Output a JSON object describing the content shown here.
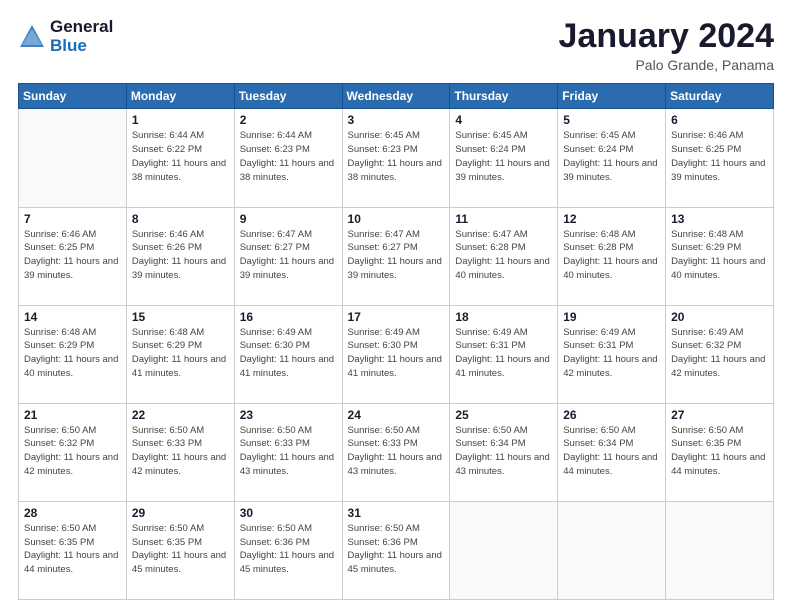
{
  "header": {
    "logo_general": "General",
    "logo_blue": "Blue",
    "month_title": "January 2024",
    "location": "Palo Grande, Panama"
  },
  "days_of_week": [
    "Sunday",
    "Monday",
    "Tuesday",
    "Wednesday",
    "Thursday",
    "Friday",
    "Saturday"
  ],
  "weeks": [
    [
      {
        "day": "",
        "sunrise": "",
        "sunset": "",
        "daylight": ""
      },
      {
        "day": "1",
        "sunrise": "Sunrise: 6:44 AM",
        "sunset": "Sunset: 6:22 PM",
        "daylight": "Daylight: 11 hours and 38 minutes."
      },
      {
        "day": "2",
        "sunrise": "Sunrise: 6:44 AM",
        "sunset": "Sunset: 6:23 PM",
        "daylight": "Daylight: 11 hours and 38 minutes."
      },
      {
        "day": "3",
        "sunrise": "Sunrise: 6:45 AM",
        "sunset": "Sunset: 6:23 PM",
        "daylight": "Daylight: 11 hours and 38 minutes."
      },
      {
        "day": "4",
        "sunrise": "Sunrise: 6:45 AM",
        "sunset": "Sunset: 6:24 PM",
        "daylight": "Daylight: 11 hours and 39 minutes."
      },
      {
        "day": "5",
        "sunrise": "Sunrise: 6:45 AM",
        "sunset": "Sunset: 6:24 PM",
        "daylight": "Daylight: 11 hours and 39 minutes."
      },
      {
        "day": "6",
        "sunrise": "Sunrise: 6:46 AM",
        "sunset": "Sunset: 6:25 PM",
        "daylight": "Daylight: 11 hours and 39 minutes."
      }
    ],
    [
      {
        "day": "7",
        "sunrise": "Sunrise: 6:46 AM",
        "sunset": "Sunset: 6:25 PM",
        "daylight": "Daylight: 11 hours and 39 minutes."
      },
      {
        "day": "8",
        "sunrise": "Sunrise: 6:46 AM",
        "sunset": "Sunset: 6:26 PM",
        "daylight": "Daylight: 11 hours and 39 minutes."
      },
      {
        "day": "9",
        "sunrise": "Sunrise: 6:47 AM",
        "sunset": "Sunset: 6:27 PM",
        "daylight": "Daylight: 11 hours and 39 minutes."
      },
      {
        "day": "10",
        "sunrise": "Sunrise: 6:47 AM",
        "sunset": "Sunset: 6:27 PM",
        "daylight": "Daylight: 11 hours and 39 minutes."
      },
      {
        "day": "11",
        "sunrise": "Sunrise: 6:47 AM",
        "sunset": "Sunset: 6:28 PM",
        "daylight": "Daylight: 11 hours and 40 minutes."
      },
      {
        "day": "12",
        "sunrise": "Sunrise: 6:48 AM",
        "sunset": "Sunset: 6:28 PM",
        "daylight": "Daylight: 11 hours and 40 minutes."
      },
      {
        "day": "13",
        "sunrise": "Sunrise: 6:48 AM",
        "sunset": "Sunset: 6:29 PM",
        "daylight": "Daylight: 11 hours and 40 minutes."
      }
    ],
    [
      {
        "day": "14",
        "sunrise": "Sunrise: 6:48 AM",
        "sunset": "Sunset: 6:29 PM",
        "daylight": "Daylight: 11 hours and 40 minutes."
      },
      {
        "day": "15",
        "sunrise": "Sunrise: 6:48 AM",
        "sunset": "Sunset: 6:29 PM",
        "daylight": "Daylight: 11 hours and 41 minutes."
      },
      {
        "day": "16",
        "sunrise": "Sunrise: 6:49 AM",
        "sunset": "Sunset: 6:30 PM",
        "daylight": "Daylight: 11 hours and 41 minutes."
      },
      {
        "day": "17",
        "sunrise": "Sunrise: 6:49 AM",
        "sunset": "Sunset: 6:30 PM",
        "daylight": "Daylight: 11 hours and 41 minutes."
      },
      {
        "day": "18",
        "sunrise": "Sunrise: 6:49 AM",
        "sunset": "Sunset: 6:31 PM",
        "daylight": "Daylight: 11 hours and 41 minutes."
      },
      {
        "day": "19",
        "sunrise": "Sunrise: 6:49 AM",
        "sunset": "Sunset: 6:31 PM",
        "daylight": "Daylight: 11 hours and 42 minutes."
      },
      {
        "day": "20",
        "sunrise": "Sunrise: 6:49 AM",
        "sunset": "Sunset: 6:32 PM",
        "daylight": "Daylight: 11 hours and 42 minutes."
      }
    ],
    [
      {
        "day": "21",
        "sunrise": "Sunrise: 6:50 AM",
        "sunset": "Sunset: 6:32 PM",
        "daylight": "Daylight: 11 hours and 42 minutes."
      },
      {
        "day": "22",
        "sunrise": "Sunrise: 6:50 AM",
        "sunset": "Sunset: 6:33 PM",
        "daylight": "Daylight: 11 hours and 42 minutes."
      },
      {
        "day": "23",
        "sunrise": "Sunrise: 6:50 AM",
        "sunset": "Sunset: 6:33 PM",
        "daylight": "Daylight: 11 hours and 43 minutes."
      },
      {
        "day": "24",
        "sunrise": "Sunrise: 6:50 AM",
        "sunset": "Sunset: 6:33 PM",
        "daylight": "Daylight: 11 hours and 43 minutes."
      },
      {
        "day": "25",
        "sunrise": "Sunrise: 6:50 AM",
        "sunset": "Sunset: 6:34 PM",
        "daylight": "Daylight: 11 hours and 43 minutes."
      },
      {
        "day": "26",
        "sunrise": "Sunrise: 6:50 AM",
        "sunset": "Sunset: 6:34 PM",
        "daylight": "Daylight: 11 hours and 44 minutes."
      },
      {
        "day": "27",
        "sunrise": "Sunrise: 6:50 AM",
        "sunset": "Sunset: 6:35 PM",
        "daylight": "Daylight: 11 hours and 44 minutes."
      }
    ],
    [
      {
        "day": "28",
        "sunrise": "Sunrise: 6:50 AM",
        "sunset": "Sunset: 6:35 PM",
        "daylight": "Daylight: 11 hours and 44 minutes."
      },
      {
        "day": "29",
        "sunrise": "Sunrise: 6:50 AM",
        "sunset": "Sunset: 6:35 PM",
        "daylight": "Daylight: 11 hours and 45 minutes."
      },
      {
        "day": "30",
        "sunrise": "Sunrise: 6:50 AM",
        "sunset": "Sunset: 6:36 PM",
        "daylight": "Daylight: 11 hours and 45 minutes."
      },
      {
        "day": "31",
        "sunrise": "Sunrise: 6:50 AM",
        "sunset": "Sunset: 6:36 PM",
        "daylight": "Daylight: 11 hours and 45 minutes."
      },
      {
        "day": "",
        "sunrise": "",
        "sunset": "",
        "daylight": ""
      },
      {
        "day": "",
        "sunrise": "",
        "sunset": "",
        "daylight": ""
      },
      {
        "day": "",
        "sunrise": "",
        "sunset": "",
        "daylight": ""
      }
    ]
  ]
}
